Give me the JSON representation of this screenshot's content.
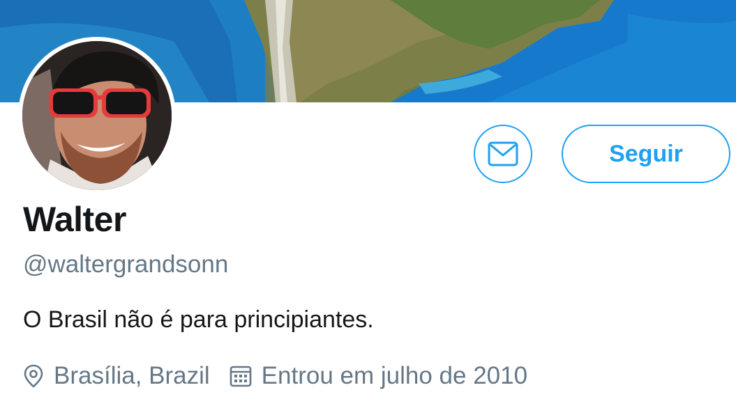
{
  "profile": {
    "display_name": "Walter",
    "handle": "@waltergrandsonn",
    "bio": "O Brasil não é para principiantes.",
    "location": "Brasília, Brazil",
    "joined": "Entrou em julho de 2010"
  },
  "actions": {
    "follow_label": "Seguir",
    "message_icon": "envelope-icon"
  },
  "icons": {
    "location": "location-pin-icon",
    "calendar": "calendar-icon"
  },
  "colors": {
    "accent": "#1da1f2",
    "name_text": "#14171a",
    "secondary_text": "#657786"
  }
}
